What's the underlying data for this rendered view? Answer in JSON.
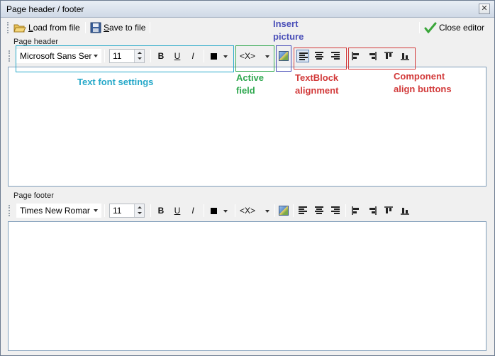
{
  "window": {
    "title": "Page header / footer",
    "close_glyph": "✕"
  },
  "toolbar": {
    "load_label_u": "L",
    "load_label_rest": "oad from file",
    "save_label_u": "S",
    "save_label_rest": "ave to file",
    "close_editor_label": "Close editor"
  },
  "header": {
    "label": "Page header",
    "font": "Microsoft Sans Ser",
    "size": "11"
  },
  "footer": {
    "label": "Page footer",
    "font": "Times New Romar",
    "size": "11"
  },
  "format": {
    "bold": "B",
    "underline": "U",
    "italic": "I",
    "field": "<X>"
  },
  "annotations": {
    "text_font_settings": "Text font settings",
    "active_field": "Active field",
    "insert_picture": "Insert picture",
    "textblock_alignment": "TextBlock alignment",
    "component_align": "Component align buttons"
  },
  "colors": {
    "annot_cyan": "#27a9c9",
    "annot_green": "#2fa84f",
    "annot_blue": "#4a4fb8",
    "annot_red": "#d23a3a",
    "editor_border": "#7f9db9"
  }
}
